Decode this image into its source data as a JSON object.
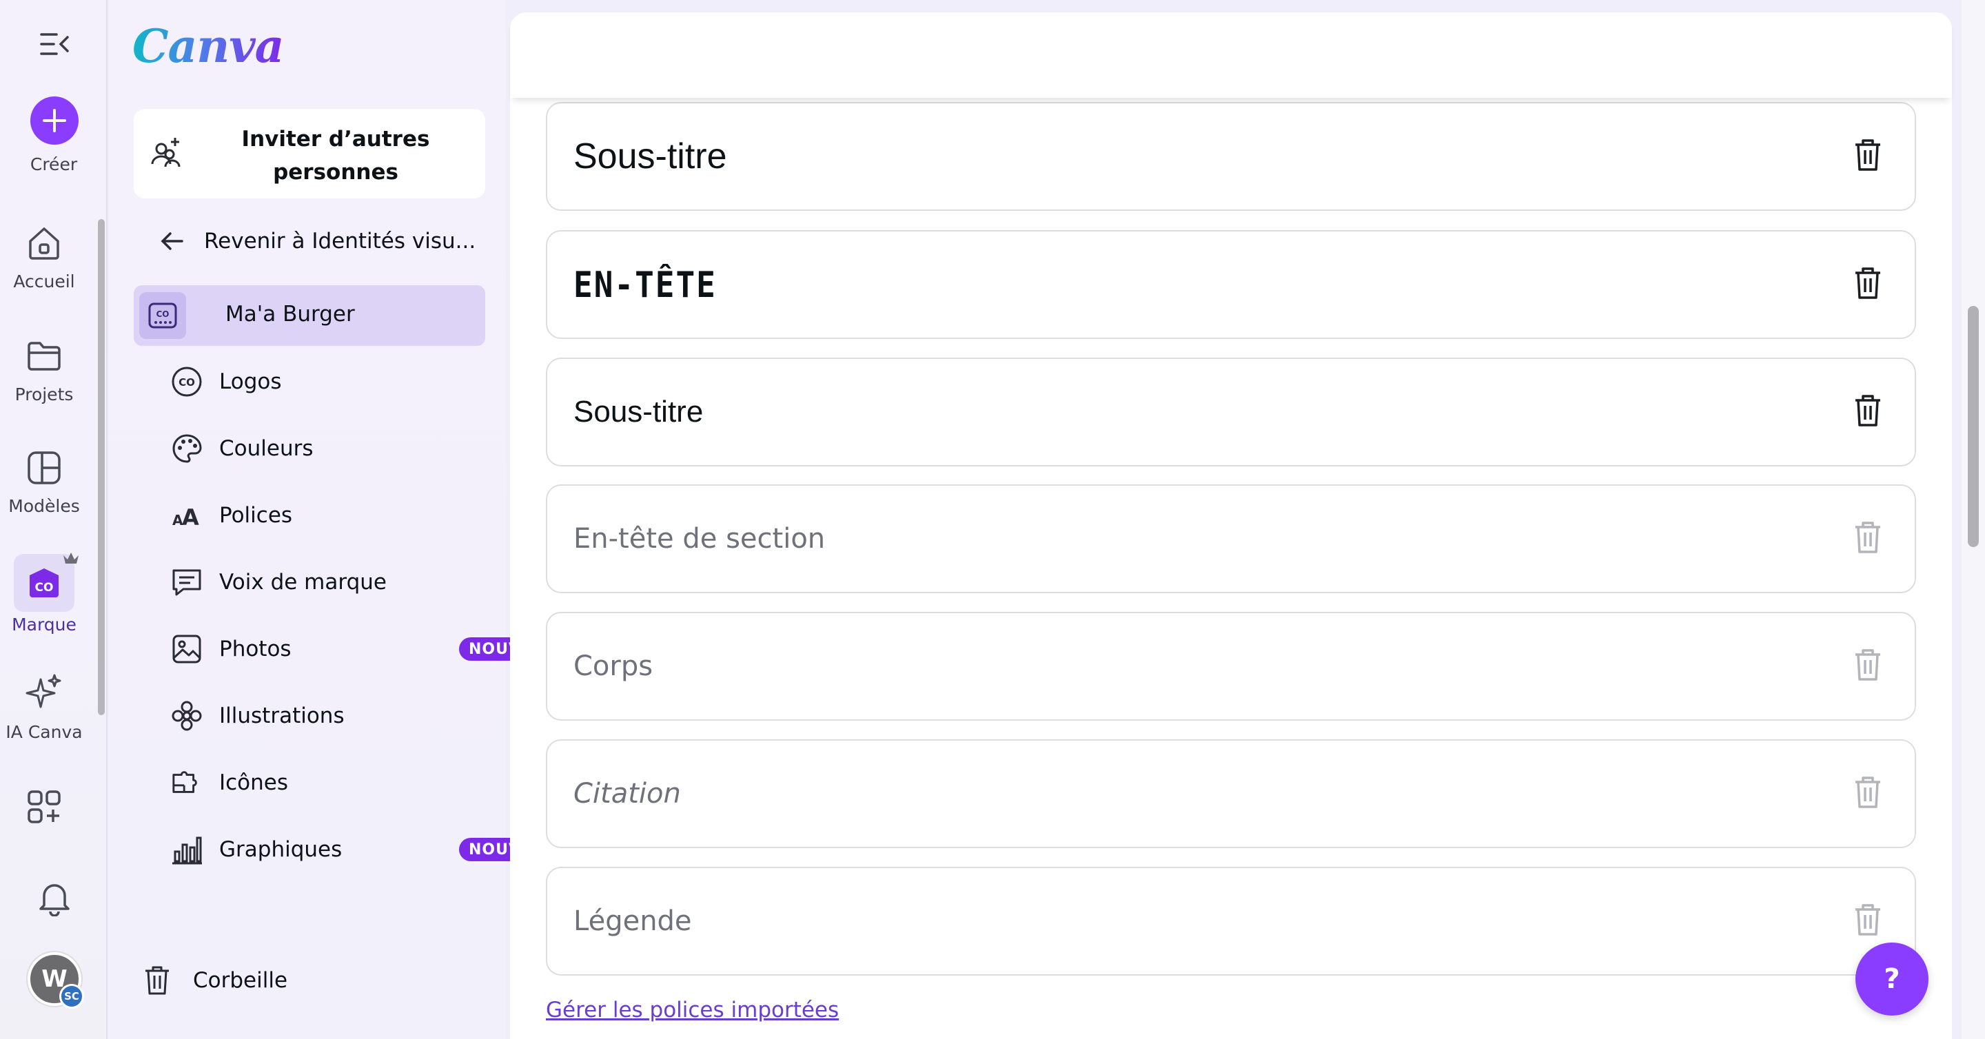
{
  "app": {
    "name": "Canva"
  },
  "rail": {
    "create_label": "Créer",
    "items": [
      {
        "label": "Accueil",
        "icon": "home-icon"
      },
      {
        "label": "Projets",
        "icon": "folder-icon"
      },
      {
        "label": "Modèles",
        "icon": "templates-icon"
      },
      {
        "label": "Marque",
        "icon": "brand-icon",
        "active": true
      },
      {
        "label": "IA Canva",
        "icon": "sparkle-icon"
      }
    ],
    "avatar_initial": "W",
    "avatar_badge": "SC"
  },
  "panel": {
    "invite_label": "Inviter d’autres personnes",
    "back_label": "Revenir à Identités visu...",
    "brand_name": "Ma'a Burger",
    "nav": [
      {
        "label": "Logos",
        "icon": "logo-icon"
      },
      {
        "label": "Couleurs",
        "icon": "palette-icon"
      },
      {
        "label": "Polices",
        "icon": "fonts-icon"
      },
      {
        "label": "Voix de marque",
        "icon": "brand-voice-icon"
      },
      {
        "label": "Photos",
        "icon": "photo-icon",
        "badge": "NOUVEAUTÉ"
      },
      {
        "label": "Illustrations",
        "icon": "illustration-icon"
      },
      {
        "label": "Icônes",
        "icon": "icons-icon"
      },
      {
        "label": "Graphiques",
        "icon": "chart-icon",
        "badge": "NOUVEAUTÉ"
      }
    ],
    "trash_label": "Corbeille"
  },
  "main": {
    "fonts": [
      {
        "label": "Sous-titre",
        "style": "large",
        "muted": false
      },
      {
        "label": "EN-TÊTE",
        "style": "header",
        "muted": false
      },
      {
        "label": "Sous-titre",
        "style": "medium",
        "muted": false
      },
      {
        "label": "En-tête de section",
        "style": "placeholder",
        "muted": true
      },
      {
        "label": "Corps",
        "style": "placeholder",
        "muted": true
      },
      {
        "label": "Citation",
        "style": "placeholder-italic",
        "muted": true
      },
      {
        "label": "Légende",
        "style": "placeholder",
        "muted": true
      }
    ],
    "manage_link": "Gérer les polices importées",
    "help_label": "?"
  },
  "colors": {
    "accent": "#8b3dff",
    "badge": "#7d2ae8",
    "active_bg": "#dcd3f7",
    "link": "#6a3dd1"
  }
}
